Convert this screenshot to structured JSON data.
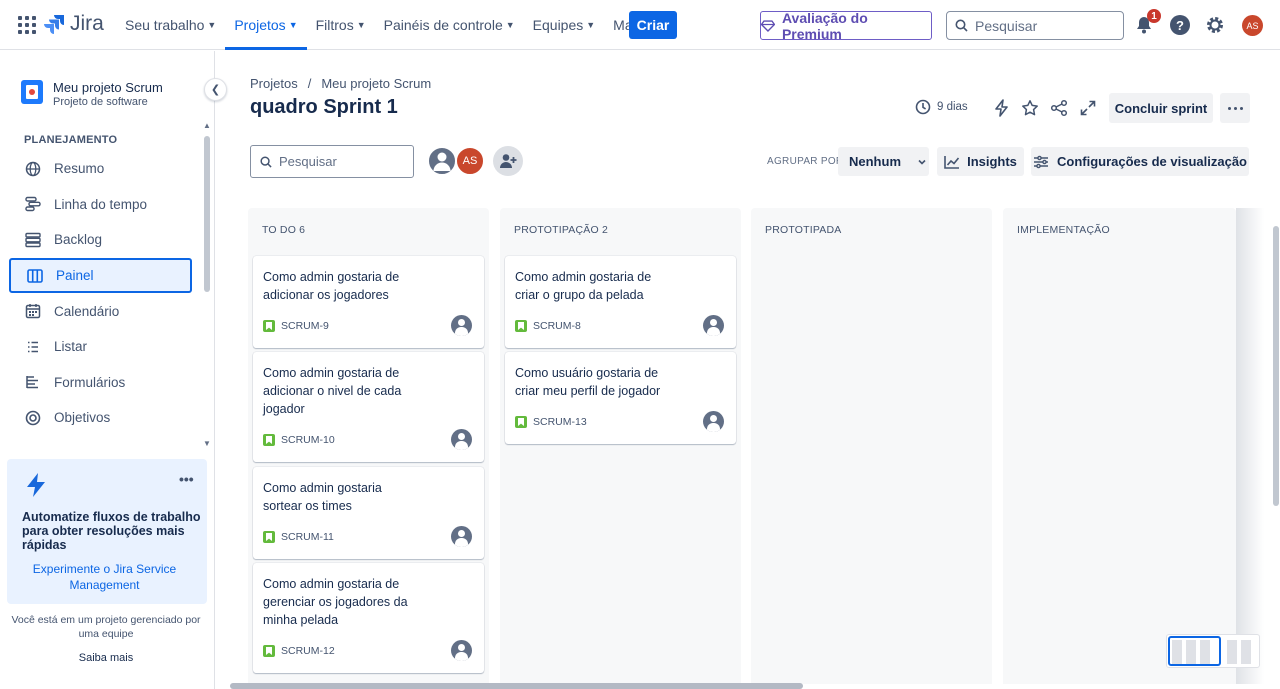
{
  "topnav": {
    "logo_text": "Jira",
    "items": [
      {
        "label": "Seu trabalho"
      },
      {
        "label": "Projetos"
      },
      {
        "label": "Filtros"
      },
      {
        "label": "Painéis de controle"
      },
      {
        "label": "Equipes"
      },
      {
        "label": "Mais"
      }
    ],
    "create_label": "Criar",
    "premium_label": "Avaliação do Premium",
    "search_placeholder": "Pesquisar",
    "notification_count": "1",
    "help_label": "?",
    "user_initials": "AS"
  },
  "sidebar": {
    "project_name": "Meu projeto Scrum",
    "project_type": "Projeto de software",
    "section_title": "PLANEJAMENTO",
    "items": [
      {
        "label": "Resumo",
        "icon": "globe-icon"
      },
      {
        "label": "Linha do tempo",
        "icon": "timeline-icon"
      },
      {
        "label": "Backlog",
        "icon": "backlog-icon"
      },
      {
        "label": "Painel",
        "icon": "board-icon",
        "selected": true
      },
      {
        "label": "Calendário",
        "icon": "calendar-icon"
      },
      {
        "label": "Listar",
        "icon": "list-icon"
      },
      {
        "label": "Formulários",
        "icon": "forms-icon"
      },
      {
        "label": "Objetivos",
        "icon": "goals-icon"
      }
    ],
    "promo": {
      "title": "Automatize fluxos de trabalho para obter resoluções mais rápidas",
      "link": "Experimente o Jira Service Management"
    },
    "footer_text": "Você está em um projeto gerenciado por uma equipe",
    "footer_link": "Saiba mais"
  },
  "board": {
    "breadcrumb": [
      "Projetos",
      "Meu projeto Scrum"
    ],
    "title": "quadro Sprint 1",
    "days_left": "9 dias",
    "complete_sprint": "Concluir sprint",
    "search_placeholder": "Pesquisar",
    "assignee_initials": "AS",
    "group_by_label": "AGRUPAR POR",
    "group_by_value": "Nenhum",
    "insights_label": "Insights",
    "view_settings_label": "Configurações de visualização",
    "columns": [
      {
        "title": "TO DO 6",
        "cards": [
          {
            "text": "Como admin gostaria de adicionar os jogadores",
            "key": "SCRUM-9"
          },
          {
            "text": "Como admin gostaria de adicionar o nivel de cada jogador",
            "key": "SCRUM-10"
          },
          {
            "text": "Como admin gostaria sortear os times",
            "key": "SCRUM-11"
          },
          {
            "text": "Como admin gostaria de gerenciar os jogadores da minha pelada",
            "key": "SCRUM-12"
          }
        ]
      },
      {
        "title": "PROTOTIPAÇÃO 2",
        "cards": [
          {
            "text": "Como admin gostaria de criar o grupo da pelada",
            "key": "SCRUM-8"
          },
          {
            "text": "Como usuário gostaria de criar meu perfil de jogador",
            "key": "SCRUM-13"
          }
        ]
      },
      {
        "title": "PROTOTIPADA",
        "cards": []
      },
      {
        "title": "IMPLEMENTAÇÃO",
        "cards": []
      }
    ]
  },
  "colors": {
    "accent": "#0c66e4",
    "story": "#63ba3c",
    "premium": "#6e5dc6",
    "avatar": "#c9472c"
  }
}
